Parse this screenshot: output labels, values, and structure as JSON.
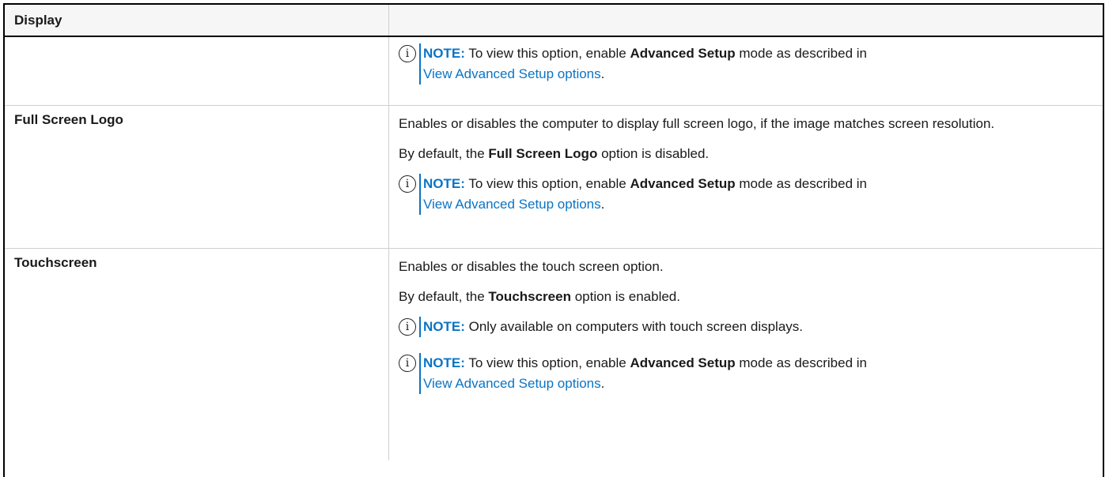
{
  "header": {
    "title": "Display"
  },
  "note_label": "NOTE:",
  "rows": [
    {
      "name": "",
      "notes": [
        {
          "before": "To view this option, enable",
          "bold": "Advanced Setup",
          "after": "mode as described in",
          "link": "View Advanced Setup options",
          "end": "."
        }
      ]
    },
    {
      "name": "Full Screen Logo",
      "description": "Enables or disables the computer to display full screen logo, if the image matches screen resolution.",
      "default_prefix": "By default, the",
      "default_bold": "Full Screen Logo",
      "default_suffix": "option is disabled.",
      "notes": [
        {
          "before": "To view this option, enable",
          "bold": "Advanced Setup",
          "after": "mode as described in",
          "link": "View Advanced Setup options",
          "end": "."
        }
      ]
    },
    {
      "name": "Touchscreen",
      "description": "Enables or disables the touch screen option.",
      "default_prefix": "By default, the",
      "default_bold": "Touchscreen",
      "default_suffix": "option is enabled.",
      "notes": [
        {
          "text": "Only available on computers with touch screen displays."
        },
        {
          "before": "To view this option, enable",
          "bold": "Advanced Setup",
          "after": "mode as described in",
          "link": "View Advanced Setup options",
          "end": "."
        }
      ]
    }
  ],
  "icons": {
    "info": "info-icon",
    "info_glyph": "i"
  },
  "colors": {
    "note_accent": "#0b74c4",
    "border": "#000000"
  }
}
